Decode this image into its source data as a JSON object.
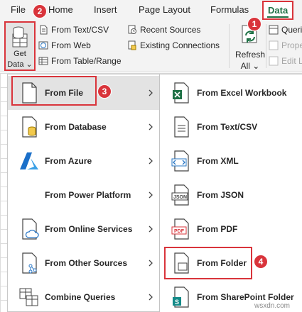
{
  "tabs": {
    "file": "File",
    "home": "Home",
    "insert": "Insert",
    "page_layout": "Page Layout",
    "formulas": "Formulas",
    "data": "Data"
  },
  "ribbon": {
    "get_data_line1": "Get",
    "get_data_line2": "Data",
    "from_text_csv": "From Text/CSV",
    "from_web": "From Web",
    "from_table_range": "From Table/Range",
    "recent_sources": "Recent Sources",
    "existing_connections": "Existing Connections",
    "refresh_line1": "Refresh",
    "refresh_line2": "All",
    "queries": "Queri",
    "properties": "Prope",
    "edit_links": "Edit Li"
  },
  "menu1": {
    "items": [
      {
        "label": "From File",
        "active": true
      },
      {
        "label": "From Database"
      },
      {
        "label": "From Azure"
      },
      {
        "label": "From Power Platform"
      },
      {
        "label": "From Online Services"
      },
      {
        "label": "From Other Sources"
      },
      {
        "label": "Combine Queries"
      }
    ]
  },
  "menu2": {
    "items": [
      {
        "label": "From Excel Workbook"
      },
      {
        "label": "From Text/CSV"
      },
      {
        "label": "From XML"
      },
      {
        "label": "From JSON"
      },
      {
        "label": "From PDF"
      },
      {
        "label": "From Folder"
      },
      {
        "label": "From SharePoint Folder"
      }
    ]
  },
  "badges": {
    "b1": "1",
    "b2": "2",
    "b3": "3",
    "b4": "4"
  },
  "watermark": "wsxdn.com",
  "colors": {
    "accent_red": "#d9343b",
    "excel_green": "#1e7145",
    "icon_blue": "#2b78c6"
  }
}
